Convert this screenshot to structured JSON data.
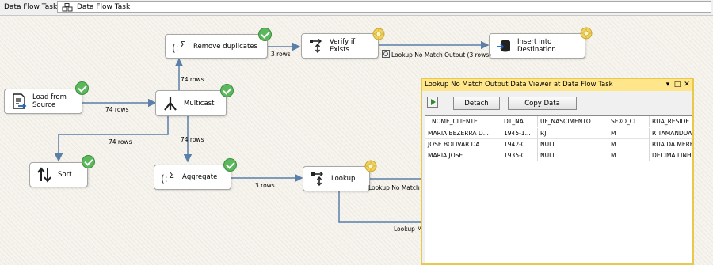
{
  "toolbar": {
    "label": "Data Flow Task:",
    "selected_task": "Data Flow Task"
  },
  "components": {
    "load": "Load from\nSource",
    "multicast": "Multicast",
    "sort": "Sort",
    "remove_dup": "Remove duplicates",
    "aggregate": "Aggregate",
    "verify": "Verify if\nExists",
    "insert": "Insert into\nDestination",
    "lookup": "Lookup"
  },
  "paths": {
    "load_to_multicast": "74 rows",
    "multicast_to_remove": "74 rows",
    "multicast_to_aggregate": "74 rows",
    "multicast_to_sort": "74 rows",
    "remove_to_verify": "3 rows",
    "aggregate_to_lookup": "3 rows",
    "verify_to_insert": "Lookup No Match Output (3 rows)",
    "lookup_nomatch": "Lookup No Match",
    "lookup_match": "Lookup Ma"
  },
  "viewer": {
    "title": "Lookup No Match Output Data Viewer at Data Flow Task",
    "detach": "Detach",
    "copy": "Copy Data",
    "columns": [
      "NOME_CLIENTE",
      "DT_NA...",
      "UF_NASCIMENTO...",
      "SEXO_CL...",
      "RUA_RESIDE"
    ],
    "rows": [
      [
        "MARIA BEZERRA D...",
        "1945-1...",
        "RJ",
        "M",
        "R TAMANDUAT"
      ],
      [
        "JOSE BOLIVAR DA ...",
        "1942-0...",
        "NULL",
        "M",
        "RUA DA MERE"
      ],
      [
        "MARIA JOSE",
        "1935-0...",
        "NULL",
        "M",
        "DECIMA LINHA"
      ]
    ]
  },
  "colors": {
    "ok_badge": "#5cb85c",
    "pending_badge": "#f0d060",
    "viewer_title": "#ffe68a",
    "connector": "#5a7fa8"
  }
}
